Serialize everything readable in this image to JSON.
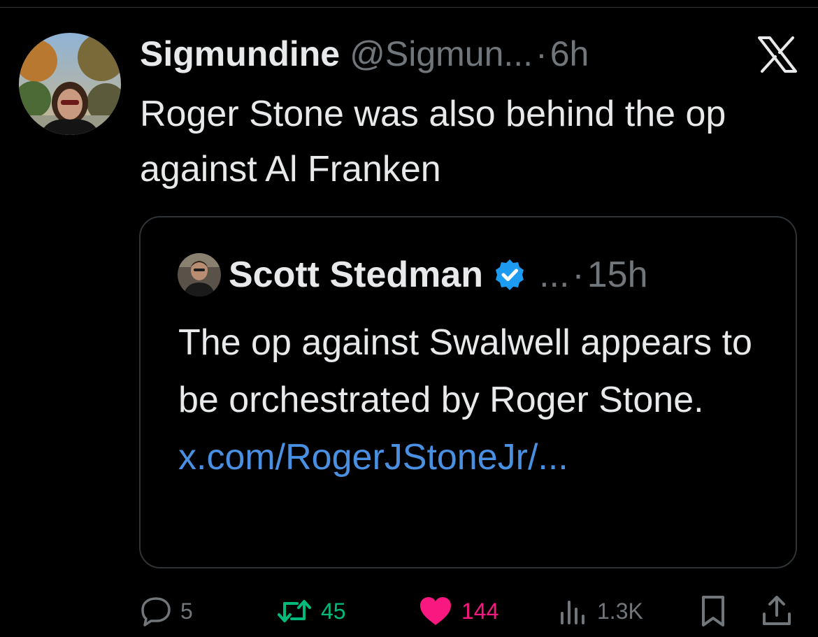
{
  "tweet": {
    "author": {
      "display_name": "Sigmundine",
      "handle": "@Sigmun...",
      "separator": "·",
      "time": "6h"
    },
    "text": "Roger Stone was also behind the op against Al Franken",
    "platform_icon": "x-logo-icon"
  },
  "quoted_tweet": {
    "author": {
      "display_name": "Scott Stedman",
      "verified": true,
      "handle_truncated": "...",
      "separator": "·",
      "time": "15h"
    },
    "text": "The op against Swalwell appears to be orchestrated by Roger Stone. ",
    "link": "x.com/RogerJStoneJr/..."
  },
  "actions": {
    "reply": {
      "icon": "reply-icon",
      "count": "5"
    },
    "retweet": {
      "icon": "retweet-icon",
      "count": "45"
    },
    "like": {
      "icon": "heart-icon",
      "count": "144"
    },
    "views": {
      "icon": "views-icon",
      "count": "1.3K"
    },
    "bookmark": {
      "icon": "bookmark-icon"
    },
    "share": {
      "icon": "share-icon"
    }
  },
  "colors": {
    "background": "#000000",
    "text_primary": "#e7e9ea",
    "text_secondary": "#71767b",
    "link": "#4a90e2",
    "retweet": "#00ba7c",
    "like": "#f91880",
    "verified": "#1d9bf0",
    "border": "#2f3336"
  }
}
